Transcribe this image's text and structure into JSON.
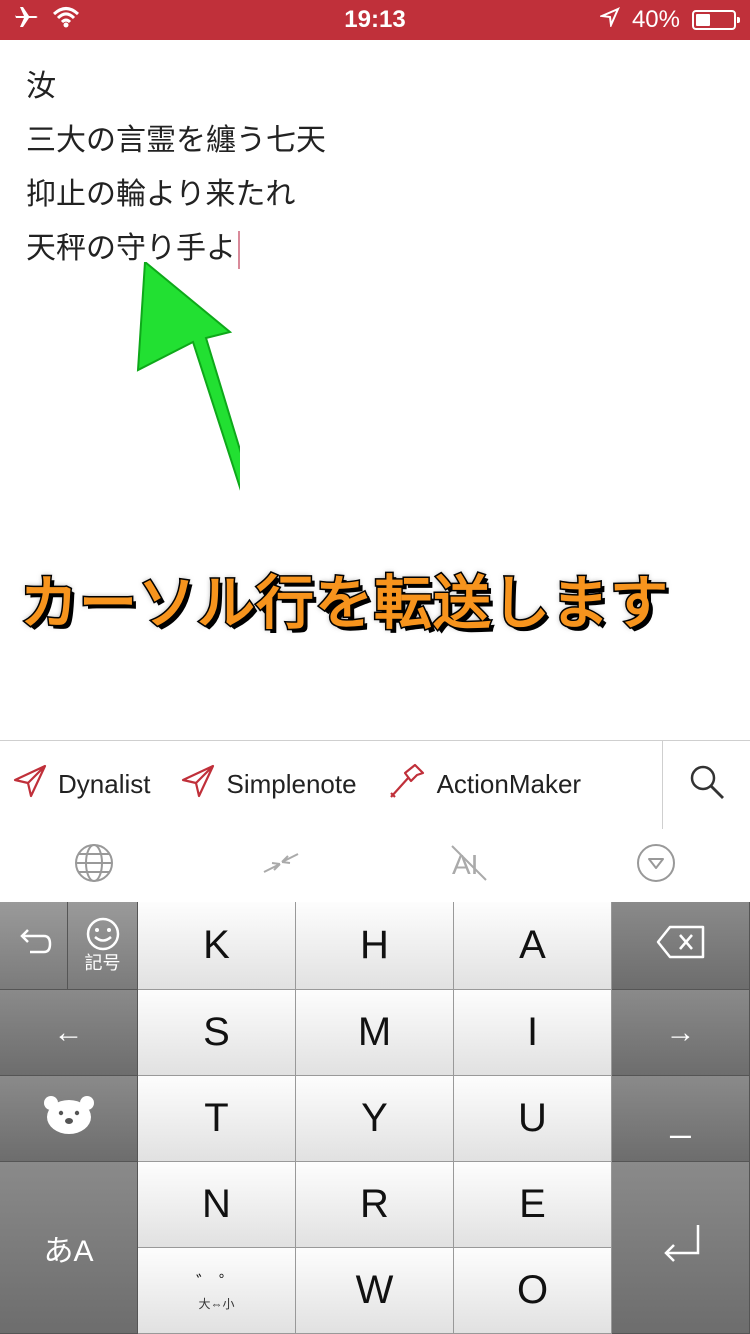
{
  "status_bar": {
    "time": "19:13",
    "battery": "40%",
    "battery_level": 0.4,
    "icons": [
      "airplane-icon",
      "wifi-icon",
      "location-icon",
      "battery-icon"
    ]
  },
  "editor": {
    "lines": [
      "汝",
      "三大の言霊を纏う七天",
      "抑止の輪より来たれ",
      "天秤の守り手よ"
    ]
  },
  "annotation": {
    "text": "カーソル行を転送します",
    "color": "#f7941d",
    "arrow_color": "#22e032"
  },
  "action_bar": {
    "items": [
      {
        "label": "Dynalist",
        "icon": "send-icon"
      },
      {
        "label": "Simplenote",
        "icon": "send-icon"
      },
      {
        "label": "ActionMaker",
        "icon": "hammer-icon"
      }
    ],
    "search_icon": "search-icon"
  },
  "keyboard_toolbar": {
    "icons": [
      "globe-icon",
      "swap-arrows-icon",
      "ai-off-icon",
      "hide-keyboard-icon"
    ]
  },
  "keyboard": {
    "undo_label": "",
    "kigou_label": "記号",
    "left_arrow": "←",
    "right_arrow": "→",
    "underscore": "_",
    "mode_label": "あA",
    "dakuten_label": "゛ ゜",
    "dakuten_sub": "大⇔小",
    "letters": [
      "K",
      "H",
      "A",
      "S",
      "M",
      "I",
      "T",
      "Y",
      "U",
      "N",
      "R",
      "E",
      "W",
      "O"
    ]
  }
}
